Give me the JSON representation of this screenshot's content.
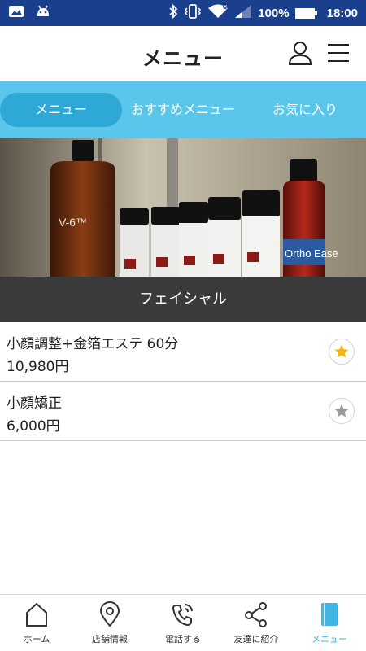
{
  "status_bar": {
    "battery": "100%",
    "time": "18:00",
    "icons": [
      "image-icon",
      "android-icon",
      "bluetooth-icon",
      "vibrate-icon",
      "wifi-icon",
      "signal-icon",
      "battery-icon"
    ]
  },
  "header": {
    "title": "メニュー",
    "icons": [
      "user-icon",
      "hamburger-menu-icon"
    ]
  },
  "tabs": [
    {
      "label": "メニュー",
      "active": true
    },
    {
      "label": "おすすめメニュー",
      "active": false
    },
    {
      "label": "お気に入り",
      "active": false
    }
  ],
  "hero": {
    "bottle_left_label": "V-6™",
    "bottle_right_label": "Ortho Ease"
  },
  "section": {
    "title": "フェイシャル"
  },
  "items": [
    {
      "name": "小顔調整+金箔エステ 60分",
      "price": "10,980円",
      "favorite": true
    },
    {
      "name": "小顔矯正",
      "price": "6,000円",
      "favorite": false
    }
  ],
  "colors": {
    "status_bar": "#1a3f8c",
    "tab_bar": "#5bc6eb",
    "tab_active": "#2ea9d6",
    "section_bar": "#3a3a3a",
    "star_active": "#f5b50a",
    "star_inactive": "#9a9a9a",
    "nav_active": "#3fb6e3"
  },
  "bottom_nav": [
    {
      "label": "ホーム",
      "icon": "home-icon",
      "active": false
    },
    {
      "label": "店舗情報",
      "icon": "location-pin-icon",
      "active": false
    },
    {
      "label": "電話する",
      "icon": "phone-icon",
      "active": false
    },
    {
      "label": "友達に紹介",
      "icon": "share-icon",
      "active": false
    },
    {
      "label": "メニュー",
      "icon": "menu-book-icon",
      "active": true
    }
  ]
}
